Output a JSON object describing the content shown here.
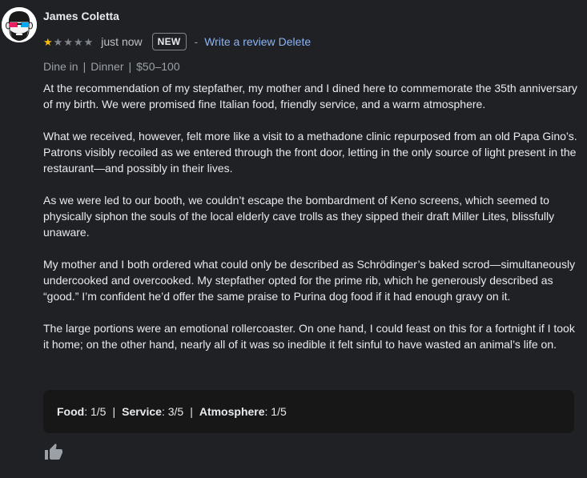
{
  "review": {
    "author": "James Coletta",
    "rating": 1,
    "max_rating": 5,
    "time": "just now",
    "badge": "NEW",
    "dash": "-",
    "write_review_label": "Write a review",
    "delete_label": "Delete",
    "tags": {
      "service": "Dine in",
      "meal": "Dinner",
      "price": "$50–100"
    },
    "paragraphs": [
      "At the recommendation of my stepfather, my mother and I dined here to commemorate the 35th anniversary of my birth. We were promised fine Italian food, friendly service, and a warm atmosphere.",
      "What we received, however, felt more like a visit to a methadone clinic repurposed from an old Papa Gino’s. Patrons visibly recoiled as we entered through the front door, letting in the only source of light present in the restaurant—and possibly in their lives.",
      "As we were led to our booth, we couldn’t escape the bombardment of Keno screens, which seemed to physically siphon the souls of the local elderly cave trolls as they sipped their draft Miller Lites, blissfully unaware.",
      "My mother and I both ordered what could only be described as Schrödinger’s baked scrod—simultaneously undercooked and overcooked. My stepfather opted for the prime rib, which he generously described as “good.” I’m confident he’d offer the same praise to Purina dog food if it had enough gravy on it.",
      "The large portions were an emotional rollercoaster. On one hand, I could feast on this for a fortnight if I took it home; on the other hand, nearly all of it was so inedible it felt sinful to have wasted an animal’s life on."
    ],
    "sub_ratings": {
      "food_label": "Food",
      "food_value": ": 1/5",
      "service_label": "Service",
      "service_value": ": 3/5",
      "atmosphere_label": "Atmosphere",
      "atmosphere_value": ": 1/5"
    }
  },
  "icons": {
    "avatar": "avatar-face-3d-glasses",
    "like": "thumbs-up-icon",
    "star": "star-icon"
  },
  "colors": {
    "background": "#202124",
    "link": "#8ab4f8",
    "star_filled": "#fbbc04",
    "star_empty": "#80868b",
    "ratings_box": "#171717"
  }
}
